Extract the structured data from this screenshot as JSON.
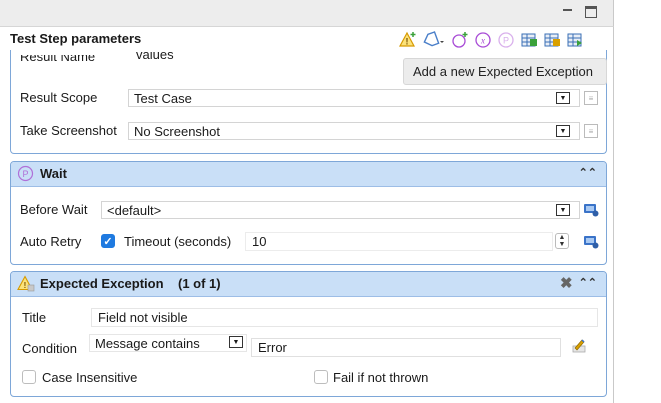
{
  "form": {
    "title": "Test Step parameters"
  },
  "tooltip": {
    "text": "Add a new Expected Exception"
  },
  "toolbar": {
    "icons": [
      "warning-add-icon",
      "tag-dropdown-icon",
      "add-parameter-icon",
      "variable-icon",
      "parameter-icon",
      "table-icon",
      "table-add-icon",
      "table-export-icon"
    ]
  },
  "result": {
    "name_label": "Result Name",
    "name_value": "values",
    "scope_label": "Result Scope",
    "scope_value": "Test Case",
    "screenshot_label": "Take Screenshot",
    "screenshot_value": "No Screenshot"
  },
  "wait": {
    "title": "Wait",
    "before_label": "Before Wait",
    "before_value": "<default>",
    "auto_retry_label": "Auto Retry",
    "auto_retry_checked": true,
    "timeout_label": "Timeout (seconds)",
    "timeout_value": "10"
  },
  "exception": {
    "title": "Expected Exception",
    "counter": "(1 of 1)",
    "title_label": "Title",
    "title_value": "Field not visible",
    "condition_label": "Condition",
    "condition_value": "Message contains",
    "condition_text": "Error",
    "case_insensitive_label": "Case Insensitive",
    "fail_if_not_thrown_label": "Fail if not thrown"
  },
  "colors": {
    "section_header": "#c9dff7",
    "section_border": "#7ea7d8",
    "checkbox_accent": "#1f7ae0"
  }
}
